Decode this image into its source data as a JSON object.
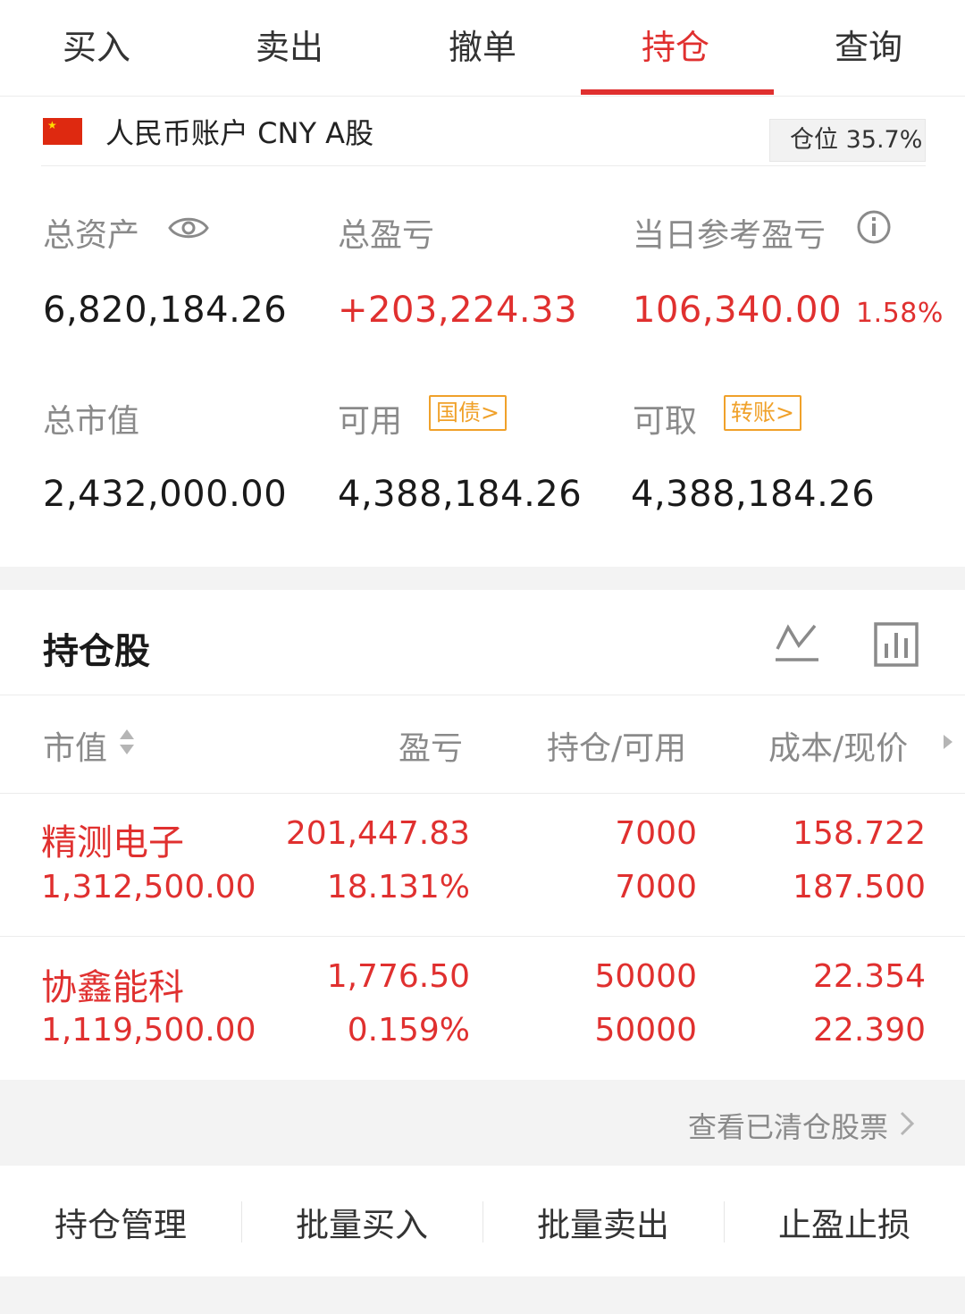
{
  "tabs": [
    "买入",
    "卖出",
    "撤单",
    "持仓",
    "查询"
  ],
  "active_tab": "持仓",
  "account": {
    "label": "人民币账户 CNY A股",
    "position_label": "仓位 35.7%"
  },
  "summary": {
    "total_assets_label": "总资产",
    "total_assets": "6,820,184.26",
    "total_pnl_label": "总盈亏",
    "total_pnl": "+203,224.33",
    "daily_pnl_label": "当日参考盈亏",
    "daily_pnl": "106,340.00",
    "daily_pnl_pct": "1.58%",
    "market_value_label": "总市值",
    "market_value": "2,432,000.00",
    "available_label": "可用",
    "available_tag": "国债>",
    "available": "4,388,184.26",
    "withdrawable_label": "可取",
    "withdrawable_tag": "转账>",
    "withdrawable": "4,388,184.26"
  },
  "holdings": {
    "title": "持仓股",
    "columns": [
      "市值",
      "盈亏",
      "持仓/可用",
      "成本/现价"
    ],
    "rows": [
      {
        "name": "精测电子",
        "market_value": "1,312,500.00",
        "pnl": "201,447.83",
        "pnl_pct": "18.131%",
        "position": "7000",
        "available": "7000",
        "cost": "158.722",
        "price": "187.500"
      },
      {
        "name": "协鑫能科",
        "market_value": "1,119,500.00",
        "pnl": "1,776.50",
        "pnl_pct": "0.159%",
        "position": "50000",
        "available": "50000",
        "cost": "22.354",
        "price": "22.390"
      }
    ],
    "cleared_link": "查看已清仓股票"
  },
  "actions": [
    "持仓管理",
    "批量买入",
    "批量卖出",
    "止盈止损"
  ],
  "colors": {
    "accent_red": "#e0302f",
    "tag_orange": "#f0a12a"
  }
}
